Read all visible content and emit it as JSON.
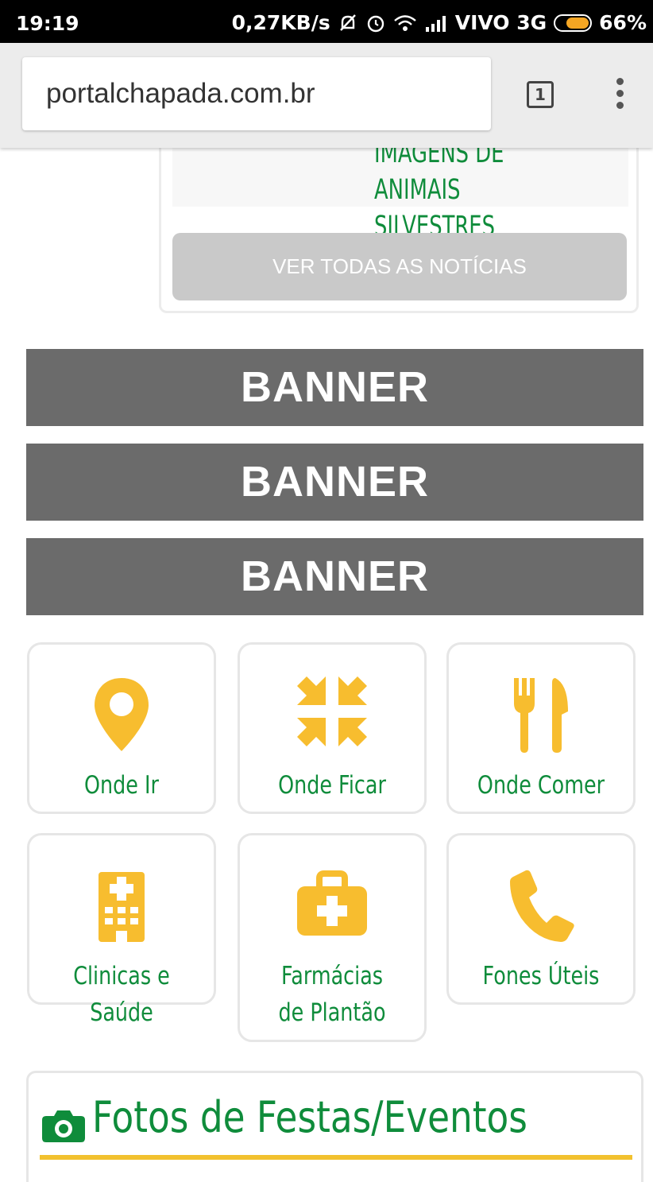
{
  "status_bar": {
    "time": "19:19",
    "speed": "0,27KB/s",
    "carrier": "VIVO 3G",
    "battery": "66%"
  },
  "browser": {
    "url": "portalchapada.com.br",
    "tab_count": "1"
  },
  "news": {
    "item_title": "IMAGENS DE ANIMAIS SILVESTRES",
    "view_all_label": "VER TODAS AS NOTÍCIAS"
  },
  "banners": [
    "BANNER",
    "BANNER",
    "BANNER"
  ],
  "tiles": [
    {
      "label": "Onde Ir",
      "icon": "map-pin-icon"
    },
    {
      "label": "Onde Ficar",
      "icon": "compress-arrows-icon"
    },
    {
      "label": "Onde Comer",
      "icon": "fork-knife-icon"
    },
    {
      "label": "Clinicas e Saúde",
      "icon": "hospital-icon"
    },
    {
      "label": "Farmácias de Plantão",
      "icon": "medical-kit-icon"
    },
    {
      "label": "Fones Úteis",
      "icon": "phone-icon"
    }
  ],
  "photos_section": {
    "title": "Fotos de Festas/Eventos",
    "icon": "camera-icon"
  },
  "colors": {
    "accent_green": "#0f8c3b",
    "icon_yellow": "#f7bd2f",
    "banner_gray": "#6b6b6b",
    "button_gray": "#c9c9c9"
  }
}
